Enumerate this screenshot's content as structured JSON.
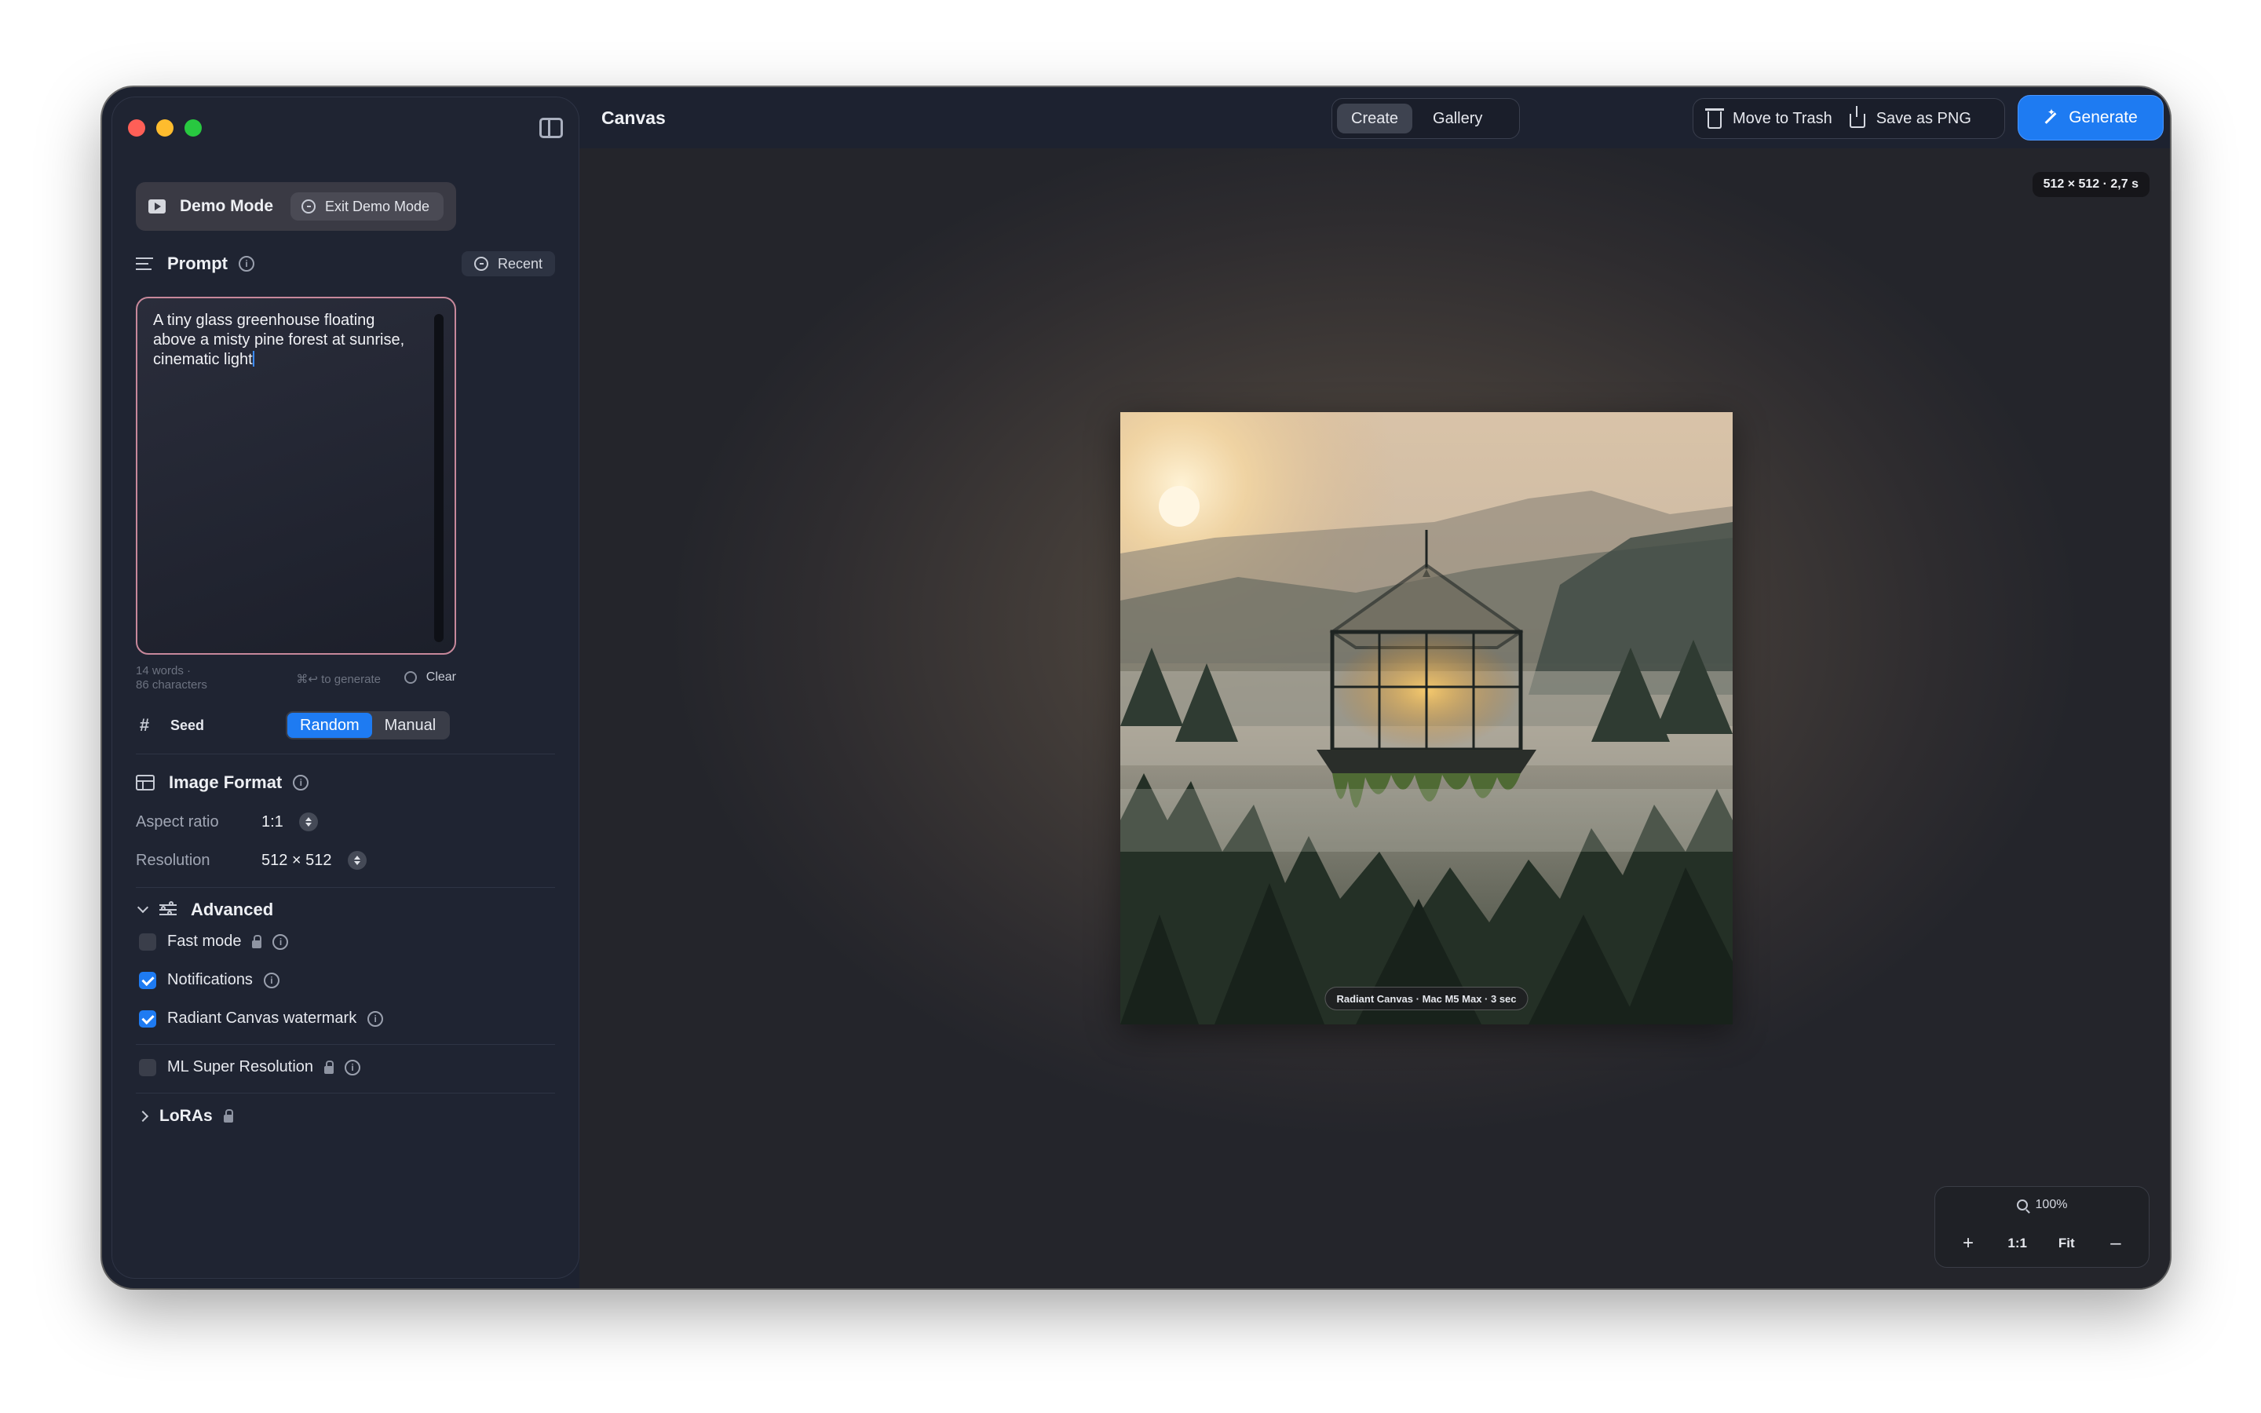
{
  "window": {
    "title": "Canvas"
  },
  "sidebar": {
    "demo": {
      "label": "Demo Mode",
      "exit_label": "Exit Demo Mode"
    },
    "prompt": {
      "title": "Prompt",
      "recent_label": "Recent",
      "text": "A tiny glass greenhouse floating above a misty pine forest at sunrise, cinematic light",
      "word_count": "14 words ·",
      "char_count": "86 characters",
      "shortcut_hint": "⌘↩ to generate",
      "clear_label": "Clear"
    },
    "seed": {
      "label": "Seed",
      "options": [
        "Random",
        "Manual"
      ],
      "selected": "Random"
    },
    "image_format": {
      "title": "Image Format",
      "aspect_ratio_label": "Aspect ratio",
      "aspect_ratio_value": "1:1",
      "resolution_label": "Resolution",
      "resolution_value": "512 × 512"
    },
    "advanced": {
      "title": "Advanced",
      "expanded": true,
      "options": [
        {
          "label": "Fast mode",
          "checked": false,
          "locked": true
        },
        {
          "label": "Notifications",
          "checked": true,
          "locked": false
        },
        {
          "label": "Radiant Canvas watermark",
          "checked": true,
          "locked": false
        },
        {
          "label": "ML Super Resolution",
          "checked": false,
          "locked": true
        }
      ]
    },
    "loras": {
      "title": "LoRAs",
      "locked": true,
      "expanded": false
    }
  },
  "toolbar": {
    "tabs": [
      {
        "label": "Create",
        "active": true
      },
      {
        "label": "Gallery",
        "active": false
      }
    ],
    "move_to_trash_label": "Move to Trash",
    "save_png_label": "Save as PNG",
    "generate_label": "Generate"
  },
  "canvas": {
    "image_info": "512 × 512 · 2,7 s",
    "watermark": "Radiant Canvas · Mac M5 Max · 3 sec",
    "zoom_level": "100%",
    "zoom_controls": {
      "zoom_in": "+",
      "actual_size": "1:1",
      "fit": "Fit",
      "zoom_out": "–"
    }
  },
  "colors": {
    "accent": "#1e7bf2",
    "window_bg": "#1d2230",
    "prompt_border": "#c7889b",
    "traffic_red": "#fe5f57",
    "traffic_yellow": "#febc2e",
    "traffic_green": "#28c840"
  }
}
